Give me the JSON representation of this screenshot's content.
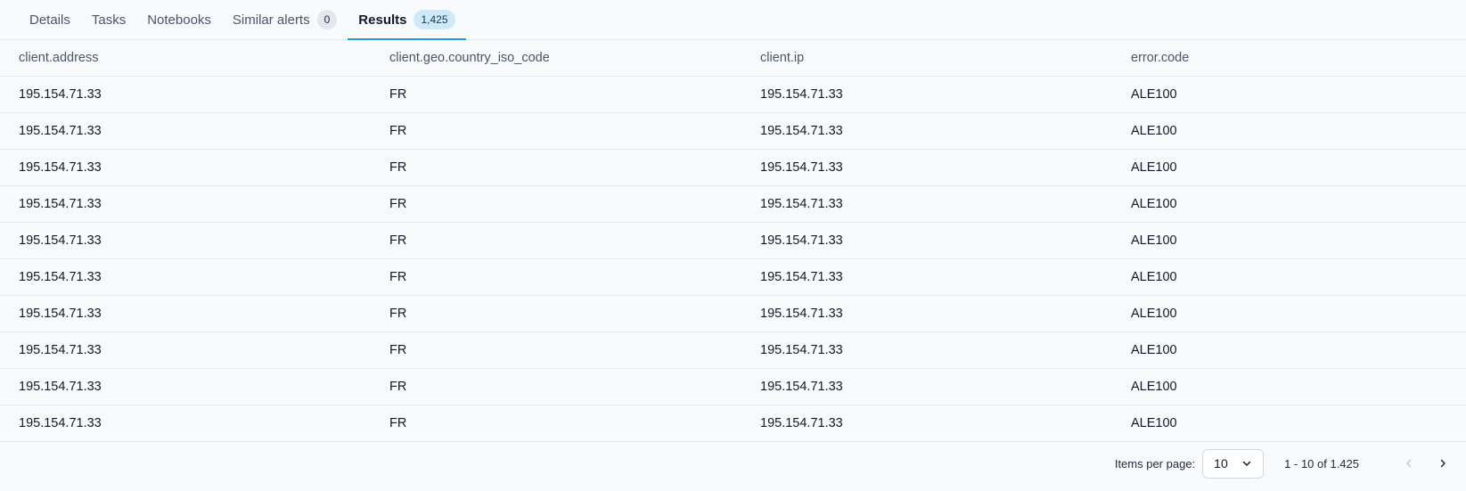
{
  "tabs": [
    {
      "label": "Details"
    },
    {
      "label": "Tasks"
    },
    {
      "label": "Notebooks"
    },
    {
      "label": "Similar alerts",
      "badge": "0"
    },
    {
      "label": "Results",
      "badge": "1,425",
      "active": true
    }
  ],
  "table": {
    "columns": [
      "client.address",
      "client.geo.country_iso_code",
      "client.ip",
      "error.code"
    ],
    "rows": [
      [
        "195.154.71.33",
        "FR",
        "195.154.71.33",
        "ALE100"
      ],
      [
        "195.154.71.33",
        "FR",
        "195.154.71.33",
        "ALE100"
      ],
      [
        "195.154.71.33",
        "FR",
        "195.154.71.33",
        "ALE100"
      ],
      [
        "195.154.71.33",
        "FR",
        "195.154.71.33",
        "ALE100"
      ],
      [
        "195.154.71.33",
        "FR",
        "195.154.71.33",
        "ALE100"
      ],
      [
        "195.154.71.33",
        "FR",
        "195.154.71.33",
        "ALE100"
      ],
      [
        "195.154.71.33",
        "FR",
        "195.154.71.33",
        "ALE100"
      ],
      [
        "195.154.71.33",
        "FR",
        "195.154.71.33",
        "ALE100"
      ],
      [
        "195.154.71.33",
        "FR",
        "195.154.71.33",
        "ALE100"
      ],
      [
        "195.154.71.33",
        "FR",
        "195.154.71.33",
        "ALE100"
      ]
    ]
  },
  "pagination": {
    "items_per_page_label": "Items per page:",
    "items_per_page_value": "10",
    "range_text": "1 - 10 of 1.425",
    "prev_icon": "chevron-left-icon",
    "next_icon": "chevron-right-icon"
  },
  "colors": {
    "accent": "#1f9bde",
    "background": "#f9fafc",
    "border": "#e3e8ef"
  }
}
